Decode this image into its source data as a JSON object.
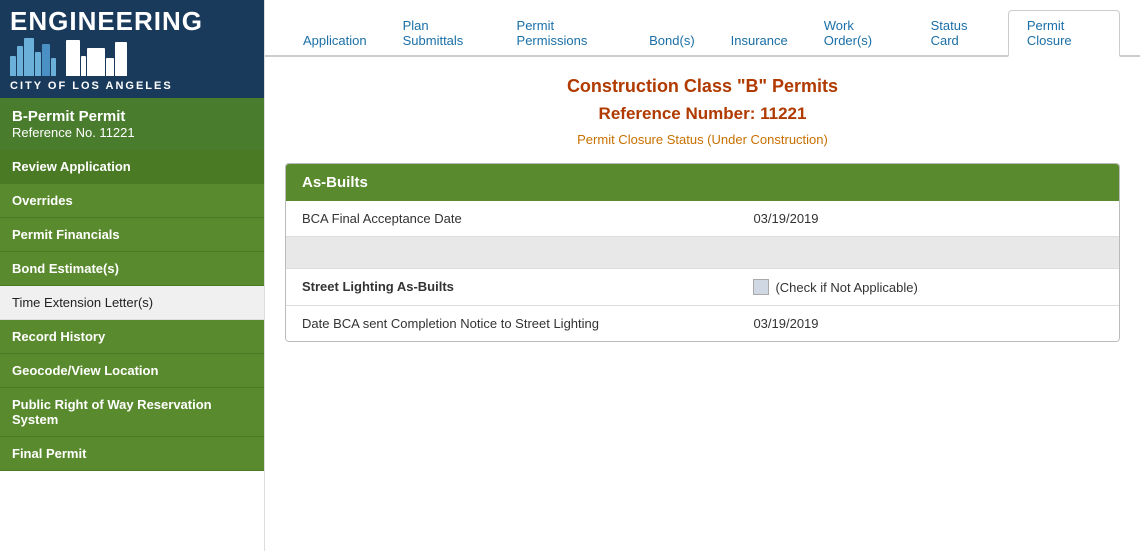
{
  "sidebar": {
    "logo": {
      "engineering": "ENGINEERING",
      "city": "CITY OF LOS ANGELES"
    },
    "permit_header": {
      "title": "B-Permit Permit",
      "ref_label": "Reference No. 11221"
    },
    "nav_items": [
      {
        "label": "Review Application",
        "active": true,
        "style": "green"
      },
      {
        "label": "Overrides",
        "active": false,
        "style": "green"
      },
      {
        "label": "Permit Financials",
        "active": false,
        "style": "green"
      },
      {
        "label": "Bond Estimate(s)",
        "active": false,
        "style": "green"
      },
      {
        "label": "Time Extension Letter(s)",
        "active": false,
        "style": "light"
      },
      {
        "label": "Record History",
        "active": false,
        "style": "green"
      },
      {
        "label": "Geocode/View Location",
        "active": false,
        "style": "green"
      },
      {
        "label": "Public Right of Way Reservation System",
        "active": false,
        "style": "green"
      },
      {
        "label": "Final Permit",
        "active": false,
        "style": "green"
      }
    ]
  },
  "tabs": [
    {
      "label": "Application",
      "active": false
    },
    {
      "label": "Plan Submittals",
      "active": false
    },
    {
      "label": "Permit Permissions",
      "active": false
    },
    {
      "label": "Bond(s)",
      "active": false
    },
    {
      "label": "Insurance",
      "active": false
    },
    {
      "label": "Work Order(s)",
      "active": false
    },
    {
      "label": "Status Card",
      "active": false
    },
    {
      "label": "Permit Closure",
      "active": true
    }
  ],
  "main": {
    "title": "Construction Class \"B\" Permits",
    "subtitle": "Reference Number: 11221",
    "status": "Permit Closure Status (Under Construction)",
    "section_title": "As-Builts",
    "rows": [
      {
        "label": "BCA Final Acceptance Date",
        "value": "03/19/2019",
        "style": "white",
        "bold": false,
        "type": "text"
      },
      {
        "label": "",
        "value": "",
        "style": "shaded",
        "bold": false,
        "type": "empty"
      },
      {
        "label": "Street Lighting As-Builts",
        "value": "(Check if Not Applicable)",
        "style": "white",
        "bold": true,
        "type": "checkbox"
      },
      {
        "label": "Date BCA sent Completion Notice to Street Lighting",
        "value": "03/19/2019",
        "style": "white",
        "bold": false,
        "type": "text"
      }
    ]
  }
}
